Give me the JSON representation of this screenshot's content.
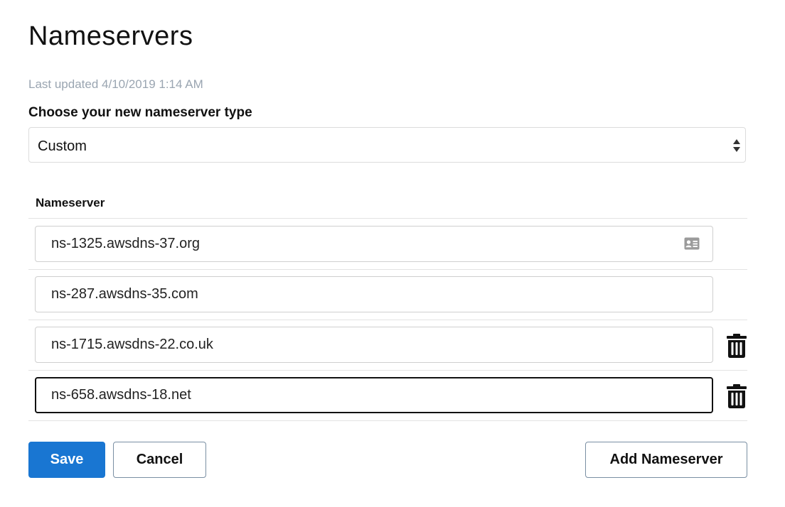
{
  "page": {
    "title": "Nameservers",
    "last_updated": "Last updated 4/10/2019 1:14 AM"
  },
  "type_select": {
    "label": "Choose your new nameserver type",
    "value": "Custom"
  },
  "table": {
    "column_header": "Nameserver",
    "rows": [
      {
        "value": "ns-1325.awsdns-37.org",
        "deletable": false,
        "icon": "contact-card-icon"
      },
      {
        "value": "ns-287.awsdns-35.com",
        "deletable": false
      },
      {
        "value": "ns-1715.awsdns-22.co.uk",
        "deletable": true,
        "icon": "trash-icon"
      },
      {
        "value": "ns-658.awsdns-18.net",
        "deletable": true,
        "focused": true,
        "icon": "trash-icon"
      }
    ]
  },
  "actions": {
    "save_label": "Save",
    "cancel_label": "Cancel",
    "add_label": "Add Nameserver"
  },
  "colors": {
    "primary": "#1976d2",
    "muted_text": "#9aa5b1",
    "border": "#cfcfcf"
  }
}
